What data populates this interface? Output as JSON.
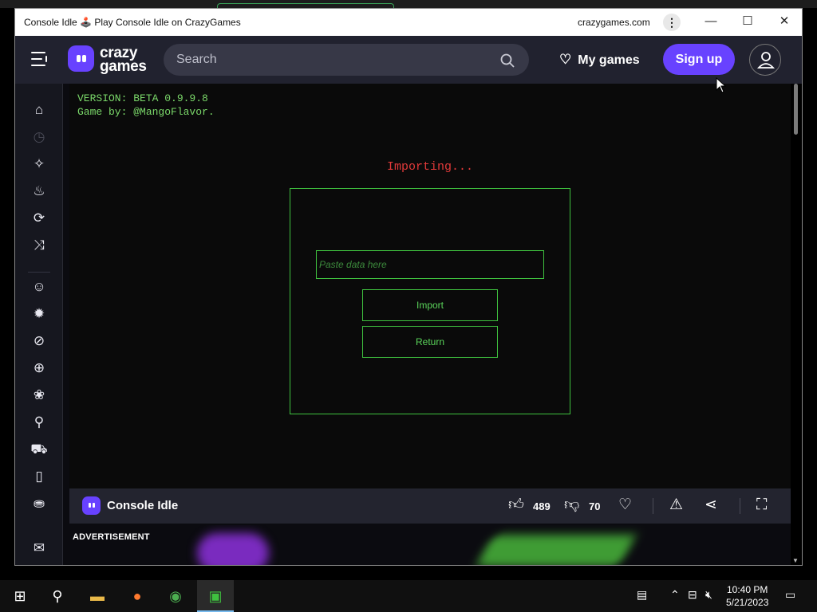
{
  "window": {
    "title": "Console Idle 🕹️ Play Console Idle on CrazyGames",
    "domain": "crazygames.com"
  },
  "nav": {
    "logo_line1": "crazy",
    "logo_line2": "games",
    "search_placeholder": "Search",
    "my_games": "My games",
    "sign_up": "Sign up",
    "accent": "#6842ff"
  },
  "sidebar": {
    "items": [
      "home-icon",
      "recent-icon",
      "new-icon",
      "trending-icon",
      "updated-icon",
      "random-icon",
      "two-player-icon",
      "action-icon",
      "adventure-icon",
      "basketball-icon",
      "casual-icon",
      "bike-icon",
      "car-icon",
      "card-icon",
      "clicker-icon",
      "mail-icon"
    ]
  },
  "game": {
    "version": "VERSION: BETA 0.9.9.8",
    "author": "Game by: @MangoFlavor.",
    "status": "Importing...",
    "paste_placeholder": "Paste data here",
    "import_button": "Import",
    "return_button": "Return",
    "green": "#3fc13f",
    "red": "#e23a3a"
  },
  "gamebar": {
    "name": "Console Idle",
    "likes": "489",
    "dislikes": "70"
  },
  "ad": {
    "label": "ADVERTISEMENT"
  },
  "taskbar": {
    "time": "10:40 PM",
    "date": "5/21/2023"
  }
}
